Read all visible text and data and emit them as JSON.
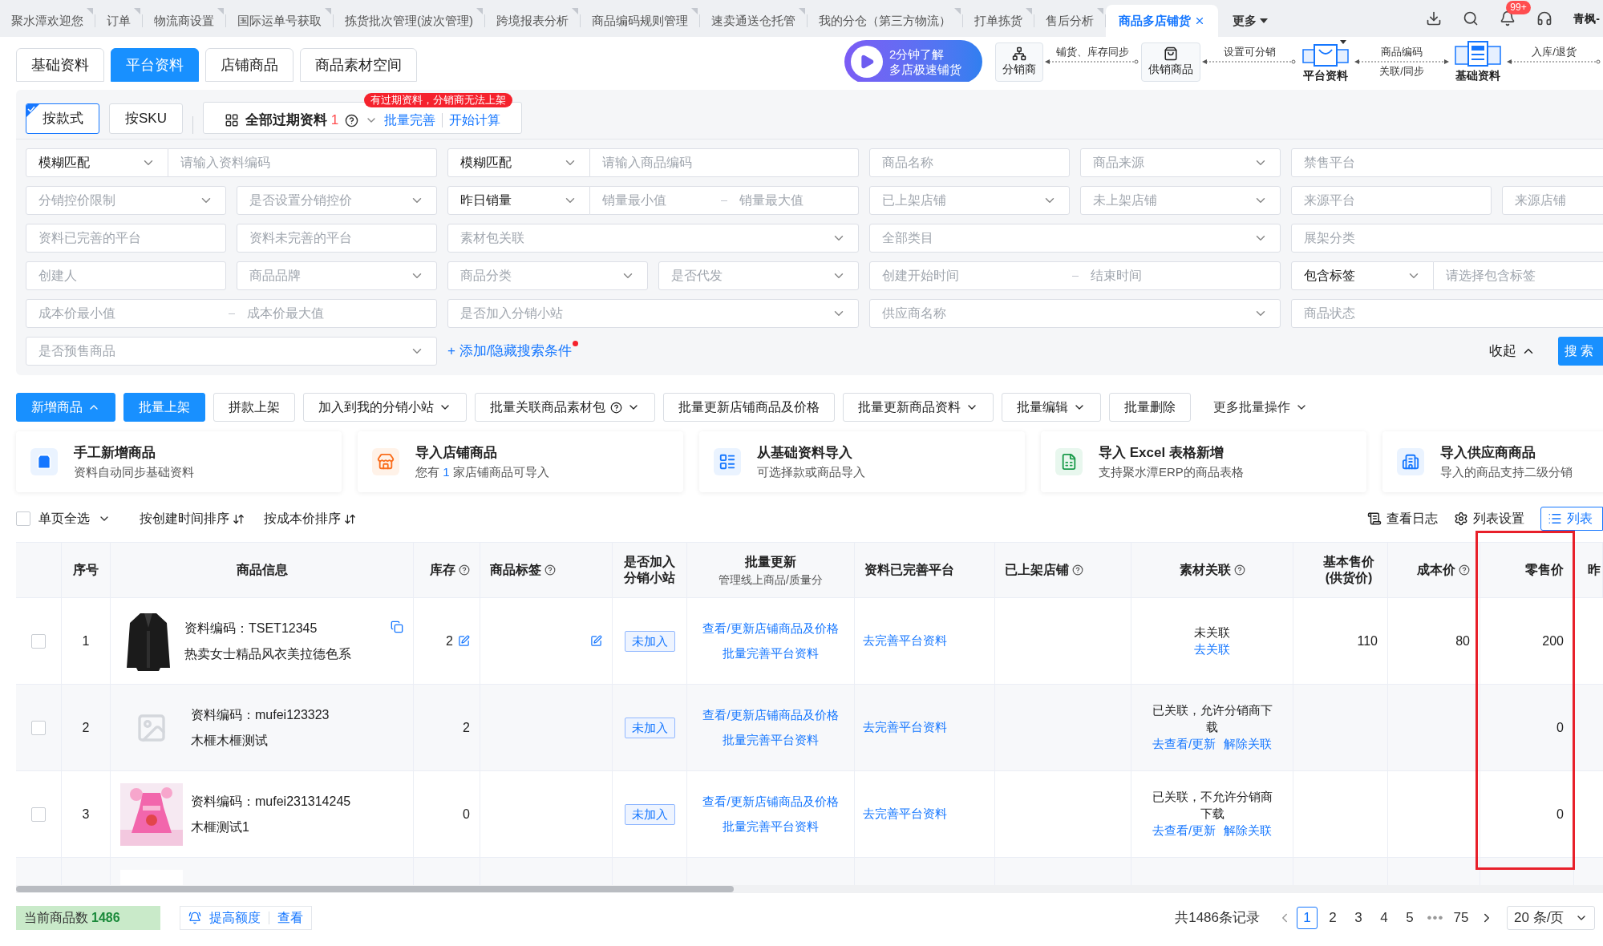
{
  "top_bar": {
    "tabs": [
      {
        "label": "聚水潭欢迎您",
        "selected": false
      },
      {
        "label": "订单",
        "selected": false
      },
      {
        "label": "物流商设置",
        "selected": false
      },
      {
        "label": "国际运单号获取",
        "selected": false
      },
      {
        "label": "拣货批次管理(波次管理)",
        "selected": false
      },
      {
        "label": "跨境报表分析",
        "selected": false
      },
      {
        "label": "商品编码规则管理",
        "selected": false
      },
      {
        "label": "速卖通送仓托管",
        "selected": false
      },
      {
        "label": "我的分仓（第三方物流）",
        "selected": false
      },
      {
        "label": "打单拣货",
        "selected": false
      },
      {
        "label": "售后分析",
        "selected": false
      },
      {
        "label": "商品多店铺货",
        "selected": true
      }
    ],
    "more": "更多",
    "badge": "99+",
    "user": "青枫-"
  },
  "page_tabs": [
    {
      "label": "基础资料",
      "selected": false
    },
    {
      "label": "平台资料",
      "selected": true
    },
    {
      "label": "店铺商品",
      "selected": false
    },
    {
      "label": "商品素材空间",
      "selected": false
    }
  ],
  "promo": {
    "line1": "2分钟了解",
    "line2": "多店极速铺货"
  },
  "flow": [
    {
      "kind": "box",
      "label": "分销商"
    },
    {
      "kind": "link",
      "top": "铺货、库存同步"
    },
    {
      "kind": "box",
      "label": "供销商品"
    },
    {
      "kind": "link",
      "top": "设置可分销"
    },
    {
      "kind": "big",
      "label": "平台资料"
    },
    {
      "kind": "link",
      "top": "商品编码",
      "bottom": "关联/同步"
    },
    {
      "kind": "big",
      "label": "基础资料"
    },
    {
      "kind": "link",
      "top": "入库/退货"
    }
  ],
  "view_modes": [
    {
      "label": "按款式",
      "selected": true
    },
    {
      "label": "按SKU",
      "selected": false
    }
  ],
  "expired": {
    "label": "全部过期资料",
    "count": "1",
    "links": [
      "批量完善",
      "开始计算"
    ],
    "badge": "有过期资料，分销商无法上架"
  },
  "filters": {
    "fields": [
      {
        "kind": "combo",
        "value": "模糊匹配",
        "placeholder": "请输入资料编码"
      },
      {
        "kind": "combo",
        "value": "模糊匹配",
        "placeholder": "请输入商品编码"
      },
      {
        "kind": "input",
        "placeholder": "商品名称"
      },
      {
        "kind": "select",
        "placeholder": "商品来源"
      },
      {
        "kind": "input",
        "placeholder": "禁售平台"
      },
      {
        "kind": "select",
        "placeholder": "分销控价限制"
      },
      {
        "kind": "select",
        "placeholder": "是否设置分销控价"
      },
      {
        "kind": "combo_range",
        "value": "昨日销量",
        "placeholders": [
          "销量最小值",
          "销量最大值"
        ]
      },
      {
        "kind": "select",
        "placeholder": "已上架店铺"
      },
      {
        "kind": "select",
        "placeholder": "未上架店铺"
      },
      {
        "kind": "input",
        "placeholder": "来源平台"
      },
      {
        "kind": "input",
        "placeholder": "来源店铺"
      },
      {
        "kind": "input",
        "placeholder": "资料已完善的平台"
      },
      {
        "kind": "input",
        "placeholder": "资料未完善的平台"
      },
      {
        "kind": "select",
        "placeholder": "素材包关联"
      },
      {
        "kind": "select",
        "placeholder": "全部类目"
      },
      {
        "kind": "input",
        "placeholder": "展架分类"
      },
      {
        "kind": "input",
        "placeholder": "创建人"
      },
      {
        "kind": "select",
        "placeholder": "商品品牌"
      },
      {
        "kind": "select",
        "placeholder": "商品分类"
      },
      {
        "kind": "select",
        "placeholder": "是否代发"
      },
      {
        "kind": "range",
        "placeholders": [
          "创建开始时间",
          "结束时间"
        ]
      },
      {
        "kind": "combo",
        "value": "包含标签",
        "placeholder": "请选择包含标签"
      },
      {
        "kind": "range",
        "placeholders": [
          "成本价最小值",
          "成本价最大值"
        ]
      },
      {
        "kind": "select",
        "placeholder": "是否加入分销小站"
      },
      {
        "kind": "select",
        "placeholder": "供应商名称"
      },
      {
        "kind": "input",
        "placeholder": "商品状态"
      },
      {
        "kind": "select",
        "placeholder": "是否预售商品"
      }
    ],
    "add_condition": "+ 添加/隐藏搜索条件",
    "collapse": "收起",
    "search": "搜索"
  },
  "toolbar": [
    {
      "label": "新增商品",
      "kind": "primary",
      "dropdown": true,
      "expanded": true
    },
    {
      "label": "批量上架",
      "kind": "primary"
    },
    {
      "label": "拼款上架",
      "kind": "default"
    },
    {
      "label": "加入到我的分销小站",
      "kind": "default",
      "dropdown": true,
      "expanded": false
    },
    {
      "label": "批量关联商品素材包",
      "kind": "default",
      "dropdown": true,
      "expanded": false,
      "help": true
    },
    {
      "label": "批量更新店铺商品及价格",
      "kind": "default"
    },
    {
      "label": "批量更新商品资料",
      "kind": "default",
      "dropdown": true,
      "expanded": false
    },
    {
      "label": "批量编辑",
      "kind": "default",
      "dropdown": true,
      "expanded": false
    },
    {
      "label": "批量删除",
      "kind": "default"
    },
    {
      "label": "更多批量操作",
      "kind": "text",
      "dropdown": true,
      "expanded": false
    }
  ],
  "cards": [
    {
      "title": "手工新增商品",
      "subtitle": "资料自动同步基础资料"
    },
    {
      "title": "导入店铺商品",
      "subtitle": "您有",
      "count": "1",
      "subtitle_after": "家店铺商品可导入"
    },
    {
      "title": "从基础资料导入",
      "subtitle": "可选择款或商品导入"
    },
    {
      "title": "导入 Excel 表格新增",
      "subtitle": "支持聚水潭ERP的商品表格"
    },
    {
      "title": "导入供应商商品",
      "subtitle": "导入的商品支持二级分销"
    }
  ],
  "list_bar": {
    "select_all": {
      "label": "单页全选",
      "checked": false
    },
    "sorts": [
      "按创建时间排序",
      "按成本价排序"
    ],
    "tools": [
      {
        "label": "查看日志",
        "selected": false
      },
      {
        "label": "列表设置",
        "selected": false
      },
      {
        "label": "列表",
        "selected": true
      }
    ]
  },
  "table": {
    "columns": [
      {
        "label": "序号"
      },
      {
        "label": "商品信息"
      },
      {
        "label": "库存",
        "help": true
      },
      {
        "label": "商品标签",
        "help": true
      },
      {
        "label": "是否加入分销小站"
      },
      {
        "label": "批量更新",
        "sublabel": "管理线上商品/质量分"
      },
      {
        "label": "资料已完善平台"
      },
      {
        "label": "已上架店铺",
        "help": true
      },
      {
        "label": "素材关联",
        "help": true
      },
      {
        "label": "基本售价(供货价)"
      },
      {
        "label": "成本价",
        "help": true
      },
      {
        "label": "零售价",
        "highlighted": true
      },
      {
        "label": "昨"
      }
    ],
    "rows": [
      {
        "selected": false,
        "index": "1",
        "code": "资料编码：TSET12345",
        "name": "热卖女士精品风衣美拉德色系",
        "copyable": true,
        "stock": "2",
        "stock_editable": true,
        "tag_editable": true,
        "station": "未加入",
        "update_links": [
          "查看/更新店铺商品及价格",
          "批量完善平台资料"
        ],
        "platform_link": "去完善平台资料",
        "association": "未关联",
        "association_links": [
          "去关联"
        ],
        "base_price": "110",
        "cost_price": "80",
        "retail_price": "200"
      },
      {
        "selected": false,
        "index": "2",
        "code": "资料编码：mufei123323",
        "name": "木榧木榧测试",
        "stock": "2",
        "station": "未加入",
        "update_links": [
          "查看/更新店铺商品及价格",
          "批量完善平台资料"
        ],
        "platform_link": "去完善平台资料",
        "association": "已关联，允许分销商下载",
        "association_links": [
          "去查看/更新",
          "解除关联"
        ],
        "retail_price": "0"
      },
      {
        "selected": false,
        "index": "3",
        "code": "资料编码：mufei231314245",
        "name": "木榧测试1",
        "stock": "0",
        "station": "未加入",
        "update_links": [
          "查看/更新店铺商品及价格",
          "批量完善平台资料"
        ],
        "platform_link": "去完善平台资料",
        "association": "已关联，不允许分销商下载",
        "association_links": [
          "去查看/更新",
          "解除关联"
        ],
        "retail_price": "0"
      },
      {
        "kind": "partial"
      }
    ]
  },
  "footer": {
    "count_label": "当前商品数",
    "count": "1486",
    "raise": "提高额度",
    "view": "查看",
    "total": "共1486条记录",
    "pages": [
      {
        "label": "1",
        "selected": true
      },
      {
        "label": "2",
        "selected": false
      },
      {
        "label": "3",
        "selected": false
      },
      {
        "label": "4",
        "selected": false
      },
      {
        "label": "5",
        "selected": false
      },
      {
        "label": "•••",
        "kind": "ellipsis",
        "selected": false
      },
      {
        "label": "75",
        "selected": false
      }
    ],
    "page_size": "20 条/页"
  }
}
